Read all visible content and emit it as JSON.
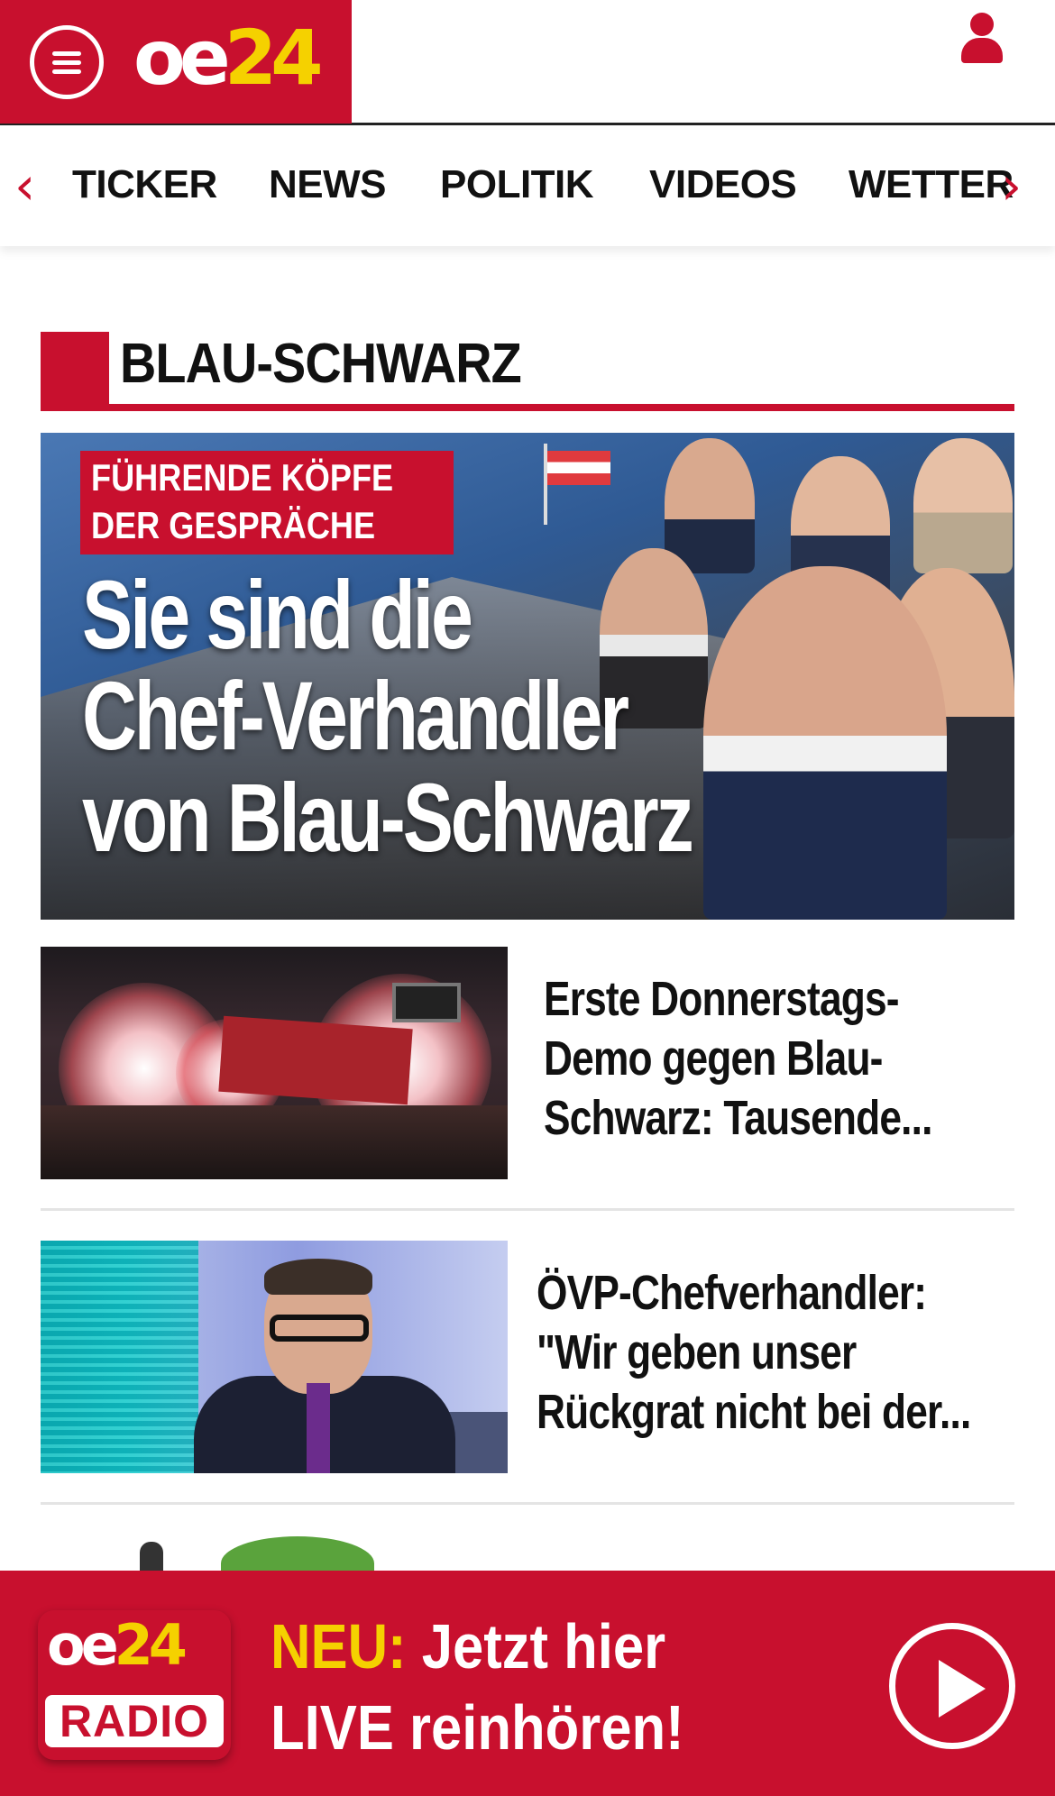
{
  "header": {
    "logo_oe": "oe",
    "logo_24": "24",
    "menu_icon": "hamburger-menu-icon",
    "user_icon": "user-icon"
  },
  "nav": {
    "items": [
      "TICKER",
      "NEWS",
      "POLITIK",
      "VIDEOS",
      "WETTER"
    ],
    "prev_arrow": "‹",
    "next_arrow": "›"
  },
  "section": {
    "title": "BLAU-SCHWARZ"
  },
  "hero": {
    "tag_line1": "FÜHRENDE KÖPFE",
    "tag_line2": "DER GESPRÄCHE",
    "headline_line1": "Sie sind die",
    "headline_line2": "Chef-Verhandler",
    "headline_line3": "von Blau-Schwarz"
  },
  "articles": [
    {
      "title_line1": "Erste Donnerstags-",
      "title_line2": "Demo gegen Blau-",
      "title_line3": "Schwarz: Tausende..."
    },
    {
      "title_line1": "ÖVP-Chefverhandler:",
      "title_line2": "\"Wir geben unser",
      "title_line3": "Rückgrat nicht bei der..."
    }
  ],
  "radio": {
    "logo_oe": "oe",
    "logo_24": "24",
    "logo_label": "RADIO",
    "highlight": "NEU:",
    "line1_rest": " Jetzt hier",
    "line2": "LIVE reinhören!"
  },
  "colors": {
    "brand_red": "#c8102e",
    "brand_yellow": "#f5d100"
  }
}
